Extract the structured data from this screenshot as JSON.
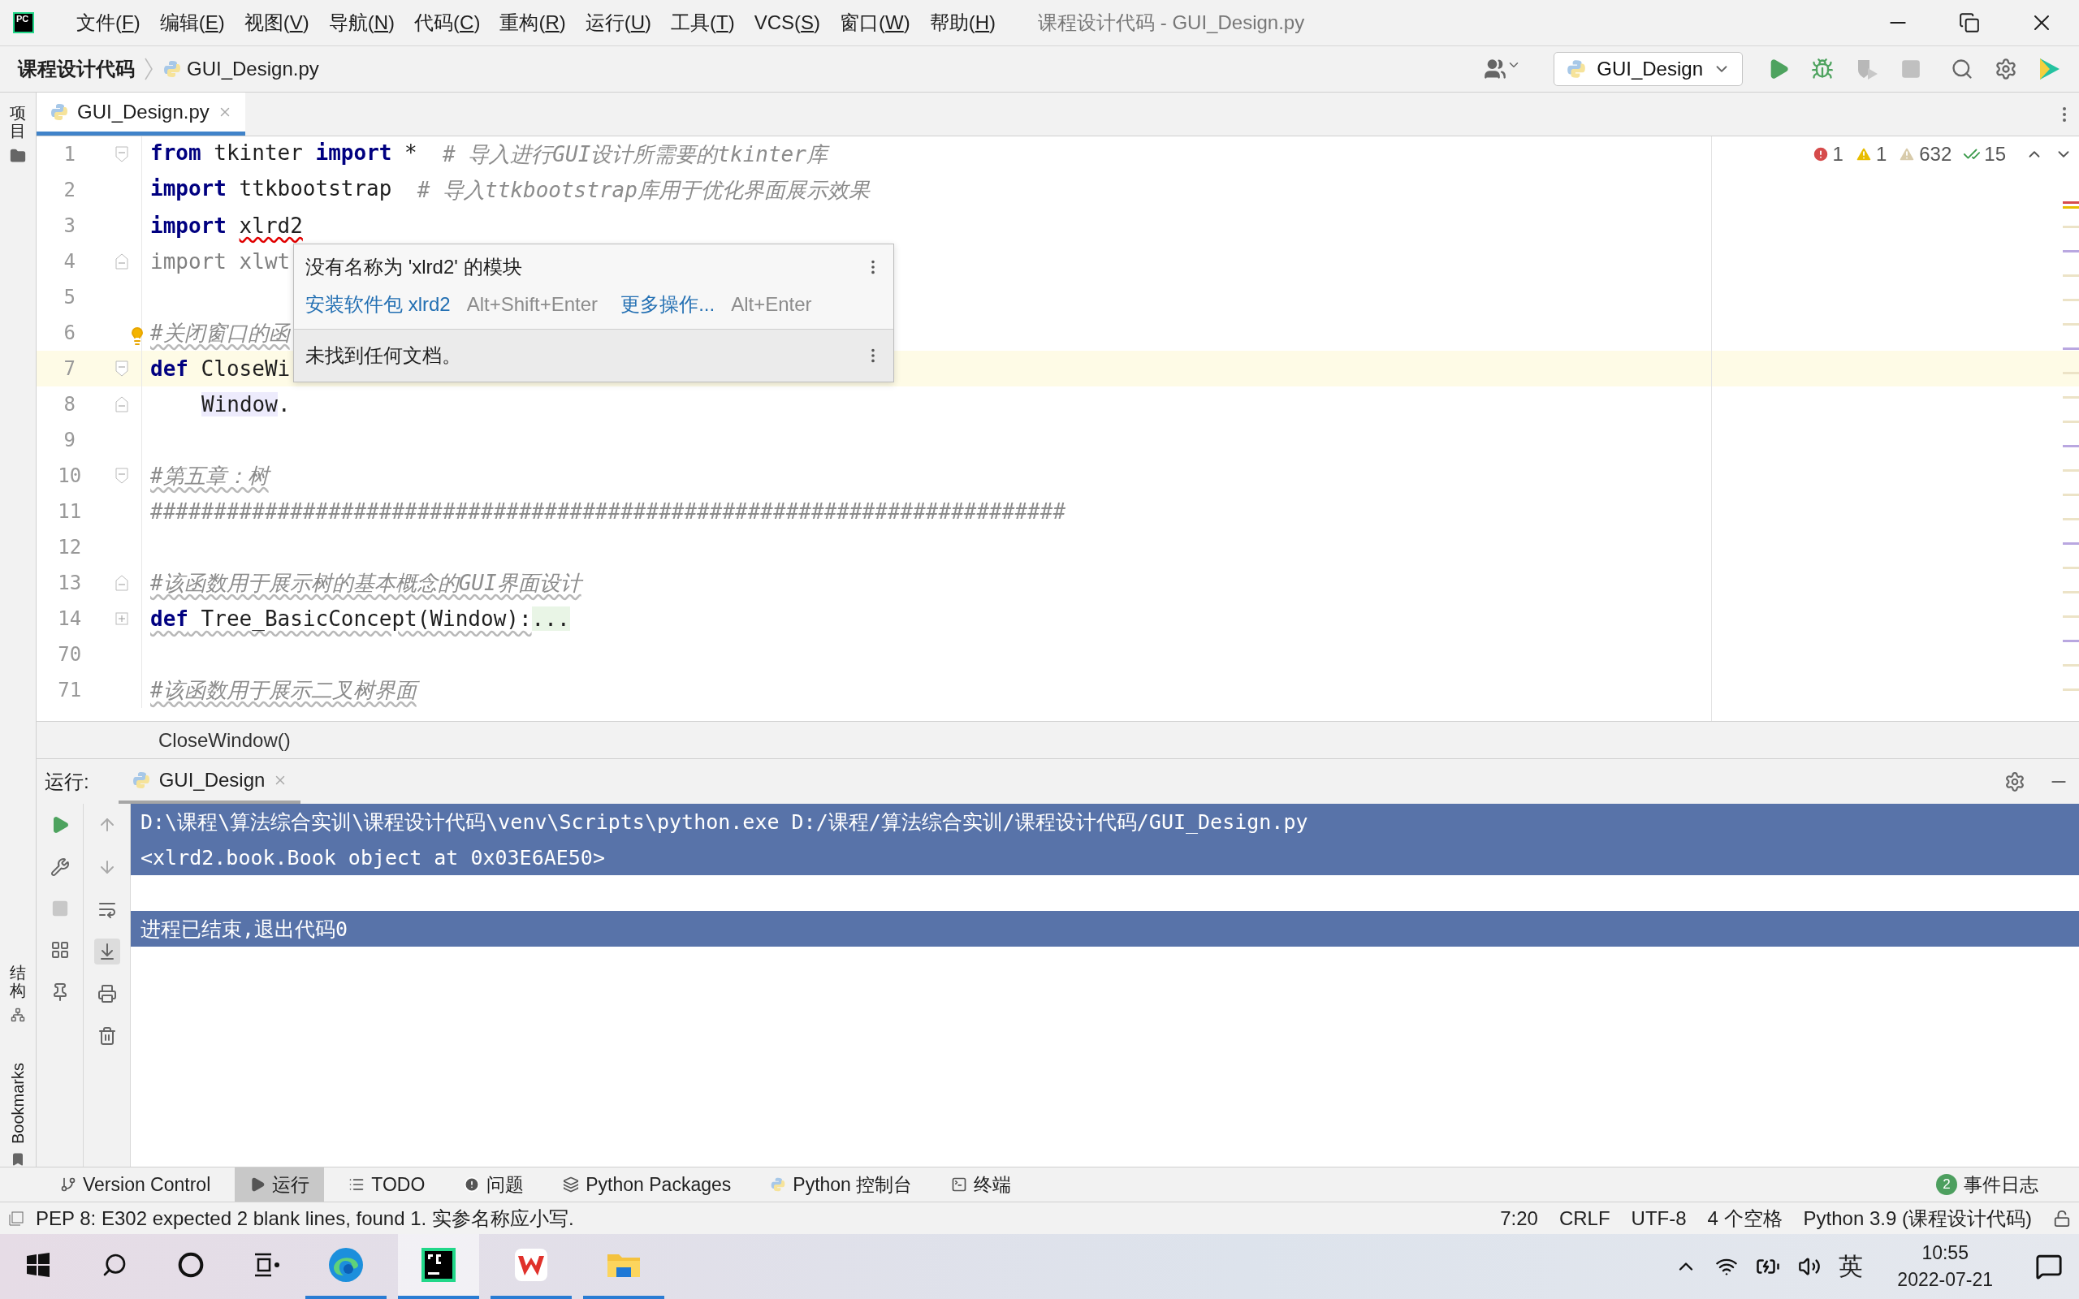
{
  "menu_bar": {
    "logo": "PC",
    "items": [
      "文件(F)",
      "编辑(E)",
      "视图(V)",
      "导航(N)",
      "代码(C)",
      "重构(R)",
      "运行(U)",
      "工具(T)",
      "VCS(S)",
      "窗口(W)",
      "帮助(H)"
    ],
    "window_title": "课程设计代码 - GUI_Design.py"
  },
  "nav_bar": {
    "breadcrumbs": [
      "课程设计代码",
      "GUI_Design.py"
    ],
    "run_config": "GUI_Design"
  },
  "side_stripe": {
    "top": "项目",
    "middle": "结构",
    "bottom": "Bookmarks"
  },
  "tabs": [
    {
      "label": "GUI_Design.py",
      "selected": true
    }
  ],
  "inspections": {
    "errors": "1",
    "warnings": "1",
    "weak_warnings": "632",
    "typos": "15"
  },
  "code_lines": [
    {
      "number": "1",
      "kind": "open",
      "current": false,
      "indented": false,
      "tokens": [
        {
          "kind": "kw",
          "text": "from"
        },
        {
          "kind": "plain",
          "text": " tkinter "
        },
        {
          "kind": "kw",
          "text": "import"
        },
        {
          "kind": "plain",
          "text": " *  "
        },
        {
          "kind": "comment",
          "text": "# 导入进行GUI设计所需要的tkinter库"
        }
      ]
    },
    {
      "number": "2",
      "kind": "plain",
      "current": false,
      "indented": false,
      "tokens": [
        {
          "kind": "kw",
          "text": "import"
        },
        {
          "kind": "plain",
          "text": " ttkbootstrap  "
        },
        {
          "kind": "comment",
          "text": "# 导入ttkbootstrap库用于优化界面展示效果"
        }
      ]
    },
    {
      "number": "3",
      "kind": "plain",
      "current": false,
      "indented": false,
      "tokens": [
        {
          "kind": "kw",
          "text": "import "
        },
        {
          "kind": "error",
          "text": "xlrd2"
        }
      ]
    },
    {
      "number": "4",
      "kind": "close",
      "current": false,
      "indented": false,
      "tokens": [
        {
          "kind": "unused",
          "text": "import xlwt"
        }
      ]
    },
    {
      "number": "5",
      "kind": "plain",
      "current": false
    },
    {
      "number": "6",
      "kind": "plain",
      "current": false,
      "indented": false,
      "tokens": [
        {
          "kind": "weak_comment",
          "text": "#关闭窗口的函"
        }
      ]
    },
    {
      "number": "7",
      "kind": "open",
      "current": true,
      "indented": false,
      "tokens": [
        {
          "kind": "kw",
          "text": "def"
        },
        {
          "kind": "plain",
          "text": " CloseWi"
        }
      ]
    },
    {
      "number": "8",
      "kind": "close",
      "current": false,
      "indented": true,
      "tokens": [
        {
          "kind": "usage",
          "text": "Window"
        },
        {
          "kind": "plain",
          "text": "."
        }
      ]
    },
    {
      "number": "9",
      "kind": "plain",
      "current": false
    },
    {
      "number": "10",
      "kind": "open",
      "current": false,
      "indented": false,
      "tokens": [
        {
          "kind": "weak_comment",
          "text": "#第五章：树"
        }
      ]
    },
    {
      "number": "11",
      "kind": "plain",
      "current": false,
      "indented": false,
      "tokens": [
        {
          "kind": "comment",
          "text": "########################################################################"
        }
      ]
    },
    {
      "number": "12",
      "kind": "plain",
      "current": false
    },
    {
      "number": "13",
      "kind": "close",
      "current": false,
      "indented": false,
      "tokens": [
        {
          "kind": "weak_comment",
          "text": "#该函数用于展示树的基本概念的GUI界面设计"
        }
      ]
    },
    {
      "number": "14",
      "kind": "collapsed",
      "current": false,
      "indented": false,
      "tokens": [
        {
          "kind": "weak_kw",
          "text": "def"
        },
        {
          "kind": "weak",
          "text": " Tree_BasicConcept(Window):"
        },
        {
          "kind": "folded",
          "text": "..."
        }
      ]
    },
    {
      "number": "70",
      "kind": "plain",
      "current": false
    },
    {
      "number": "71",
      "kind": "plain",
      "current": false,
      "indented": false,
      "tokens": [
        {
          "kind": "weak_comment",
          "text": "#该函数用于展示二叉树界面"
        }
      ]
    }
  ],
  "popup": {
    "message": "没有名称为 'xlrd2' 的模块",
    "actions": [
      {
        "label": "安装软件包 xlrd2",
        "shortcut": "Alt+Shift+Enter"
      },
      {
        "label": "更多操作...",
        "shortcut": "Alt+Enter"
      }
    ],
    "doc": "未找到任何文档。"
  },
  "breadcrumb": "CloseWindow()",
  "run_panel": {
    "label": "运行:",
    "tab": "GUI_Design",
    "output": [
      {
        "kind": "cmd",
        "text": "D:\\课程\\算法综合实训\\课程设计代码\\venv\\Scripts\\python.exe D:/课程/算法综合实训/课程设计代码/GUI_Design.py"
      },
      {
        "kind": "out",
        "text": "<xlrd2.book.Book object at 0x03E6AE50>"
      },
      {
        "kind": "exit",
        "text": "进程已结束,退出代码0"
      }
    ]
  },
  "tool_tabs": [
    {
      "kind": "branch",
      "label": "Version Control",
      "selected": false
    },
    {
      "kind": "run",
      "label": "运行",
      "selected": true
    },
    {
      "kind": "todo",
      "label": "TODO",
      "selected": false
    },
    {
      "kind": "problems",
      "label": "问题",
      "selected": false
    },
    {
      "kind": "packages",
      "label": "Python Packages",
      "selected": false
    },
    {
      "kind": "console",
      "label": "Python 控制台",
      "selected": false
    },
    {
      "kind": "terminal",
      "label": "终端",
      "selected": false
    }
  ],
  "event_log": {
    "count": "2",
    "label": "事件日志"
  },
  "status_bar": {
    "message": "PEP 8: E302 expected 2 blank lines, found 1. 实参名称应小写.",
    "items": [
      "7:20",
      "CRLF",
      "UTF-8",
      "4 个空格",
      "Python 3.9 (课程设计代码)"
    ]
  },
  "taskbar": {
    "apps": [
      {
        "kind": "edge",
        "selected": false
      },
      {
        "kind": "pycharm",
        "selected": true
      },
      {
        "kind": "wps",
        "selected": false
      },
      {
        "kind": "files",
        "selected": false
      }
    ],
    "ime": "英",
    "time": "10:55",
    "date": "2022-07-21"
  }
}
